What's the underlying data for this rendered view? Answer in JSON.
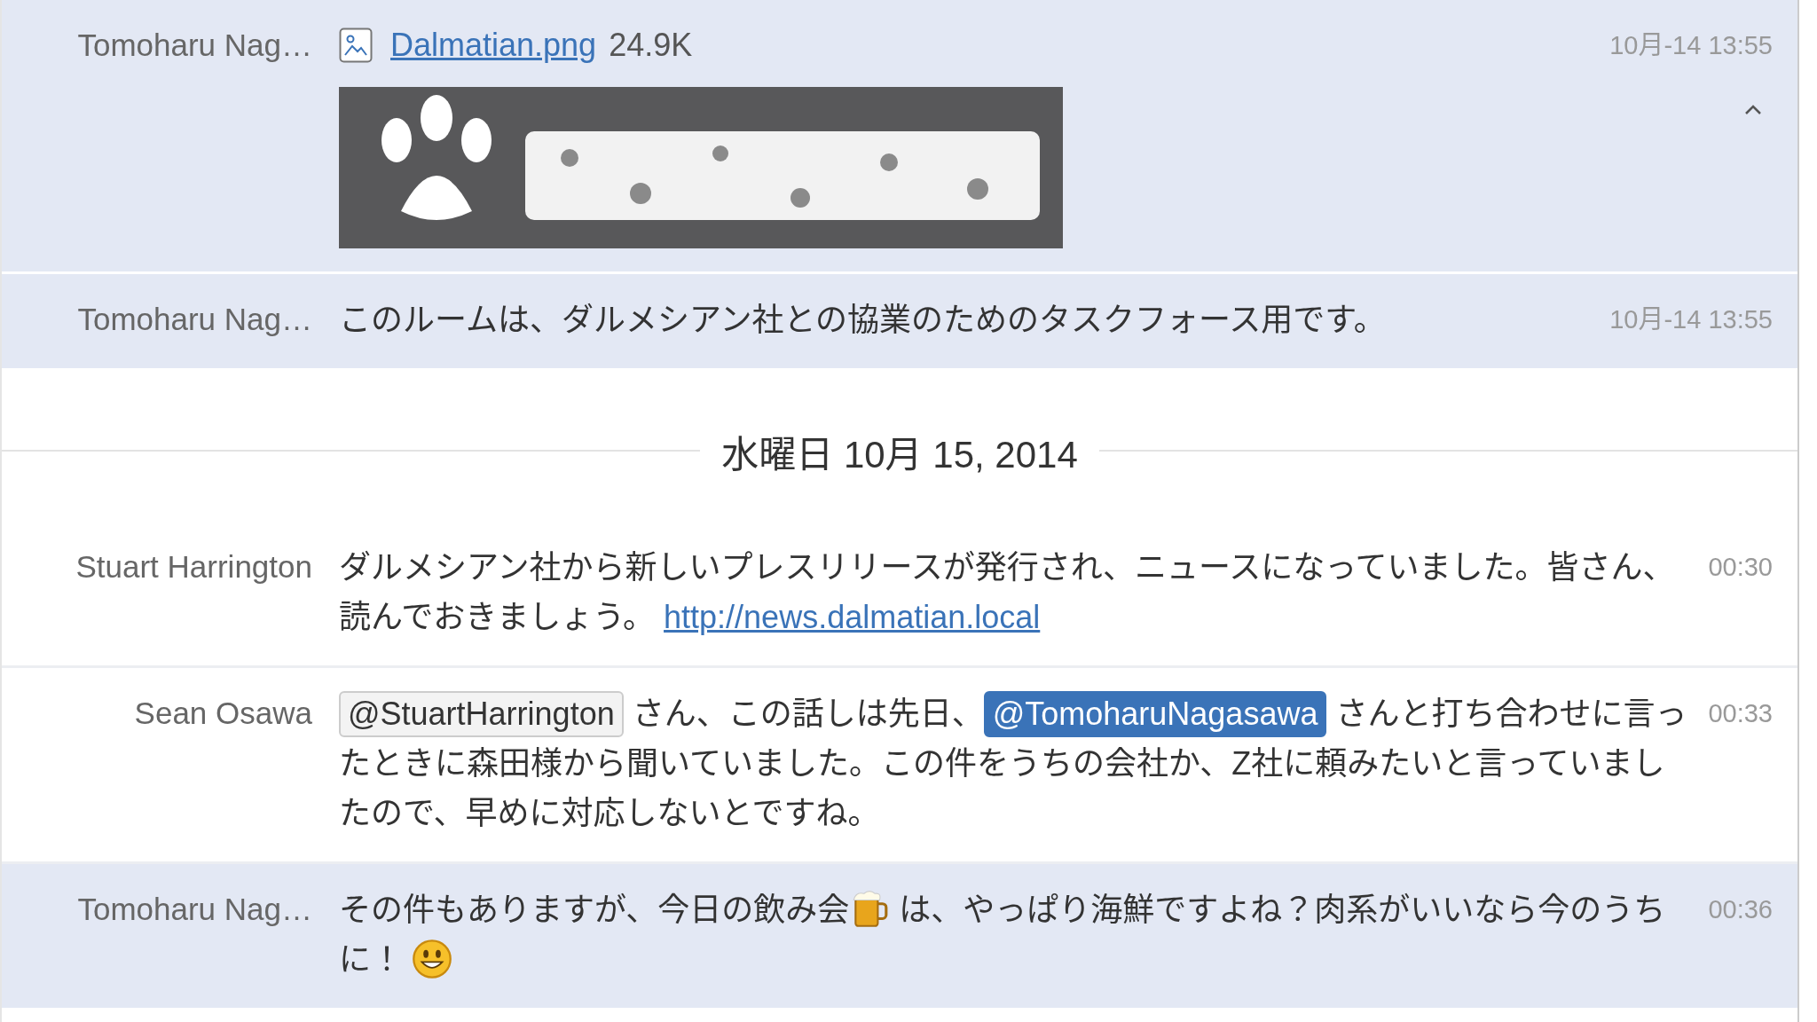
{
  "messages": [
    {
      "sender": "Tomoharu Nag…",
      "time": "10月-14 13:55",
      "highlighted": true,
      "kind": "file",
      "file": {
        "name": "Dalmatian.png",
        "size": "24.9K",
        "expanded": true
      }
    },
    {
      "sender": "Tomoharu Nag…",
      "time": "10月-14 13:55",
      "highlighted": true,
      "kind": "text",
      "segments": [
        {
          "kind": "text",
          "text": "このルームは、ダルメシアン社との協業のためのタスクフォース用です。"
        }
      ]
    },
    {
      "kind": "date",
      "text": "水曜日 10月 15, 2014"
    },
    {
      "sender": "Stuart Harrington",
      "time": "00:30",
      "highlighted": false,
      "kind": "text",
      "segments": [
        {
          "kind": "text",
          "text": "ダルメシアン社から新しいプレスリリースが発行され、ニュースになっていました。皆さん、読んでおきましょう。 "
        },
        {
          "kind": "link",
          "text": "http://news.dalmatian.local"
        }
      ]
    },
    {
      "sender": "Sean Osawa",
      "time": "00:33",
      "highlighted": false,
      "kind": "text",
      "segments": [
        {
          "kind": "mention",
          "text": "@StuartHarrington",
          "self": false
        },
        {
          "kind": "text",
          "text": " さん、この話しは先日、"
        },
        {
          "kind": "mention",
          "text": "@TomoharuNagasawa",
          "self": true
        },
        {
          "kind": "text",
          "text": " さんと打ち合わせに言ったときに森田様から聞いていました。この件をうちの会社か、Z社に頼みたいと言っていましたので、早めに対応しないとですね。"
        }
      ]
    },
    {
      "sender": "Tomoharu Nag…",
      "time": "00:36",
      "highlighted": true,
      "kind": "text",
      "segments": [
        {
          "kind": "text",
          "text": "その件もありますが、今日の飲み会"
        },
        {
          "kind": "beer"
        },
        {
          "kind": "text",
          "text": " は、やっぱり海鮮ですよね？肉系がいいなら今のうちに！ "
        },
        {
          "kind": "smiley"
        }
      ]
    }
  ]
}
